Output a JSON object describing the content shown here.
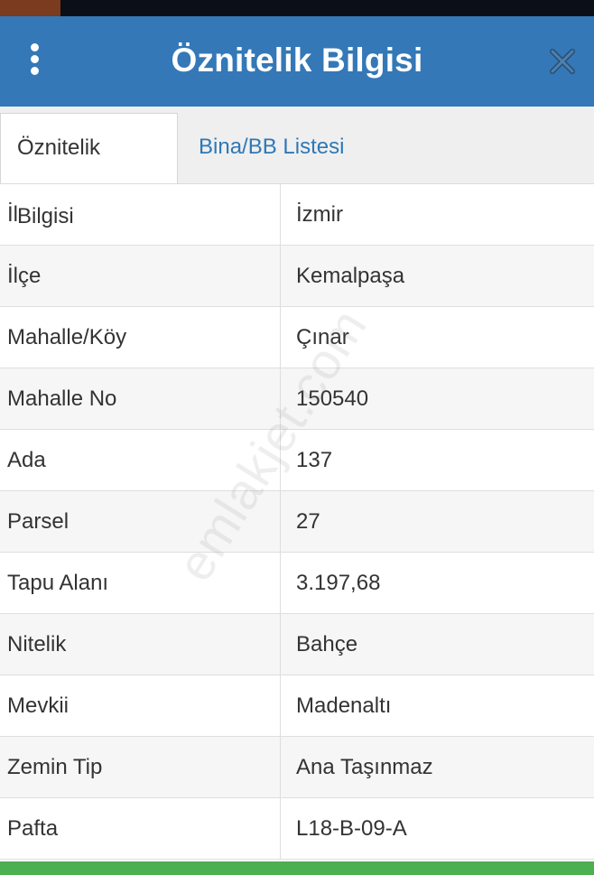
{
  "colors": {
    "header_bg": "#3478b7",
    "tab_link": "#2f78b6",
    "bottom_bar": "#4caf50"
  },
  "header": {
    "title": "Öznitelik Bilgisi",
    "menu_icon": "more-vertical-icon",
    "close_icon": "close-icon"
  },
  "tabs": [
    {
      "label": "Öznitelik Bilgisi",
      "active": true
    },
    {
      "label": "Bina/BB Listesi",
      "active": false
    }
  ],
  "attributes": [
    {
      "key": "İl",
      "value": "İzmir"
    },
    {
      "key": "İlçe",
      "value": "Kemalpaşa"
    },
    {
      "key": "Mahalle/Köy",
      "value": "Çınar"
    },
    {
      "key": "Mahalle No",
      "value": "150540"
    },
    {
      "key": "Ada",
      "value": "137"
    },
    {
      "key": "Parsel",
      "value": "27"
    },
    {
      "key": "Tapu Alanı",
      "value": "3.197,68"
    },
    {
      "key": "Nitelik",
      "value": "Bahçe"
    },
    {
      "key": "Mevkii",
      "value": "Madenaltı"
    },
    {
      "key": "Zemin Tip",
      "value": "Ana Taşınmaz"
    },
    {
      "key": "Pafta",
      "value": "L18-B-09-A"
    }
  ],
  "watermark": "emlakjet.com"
}
